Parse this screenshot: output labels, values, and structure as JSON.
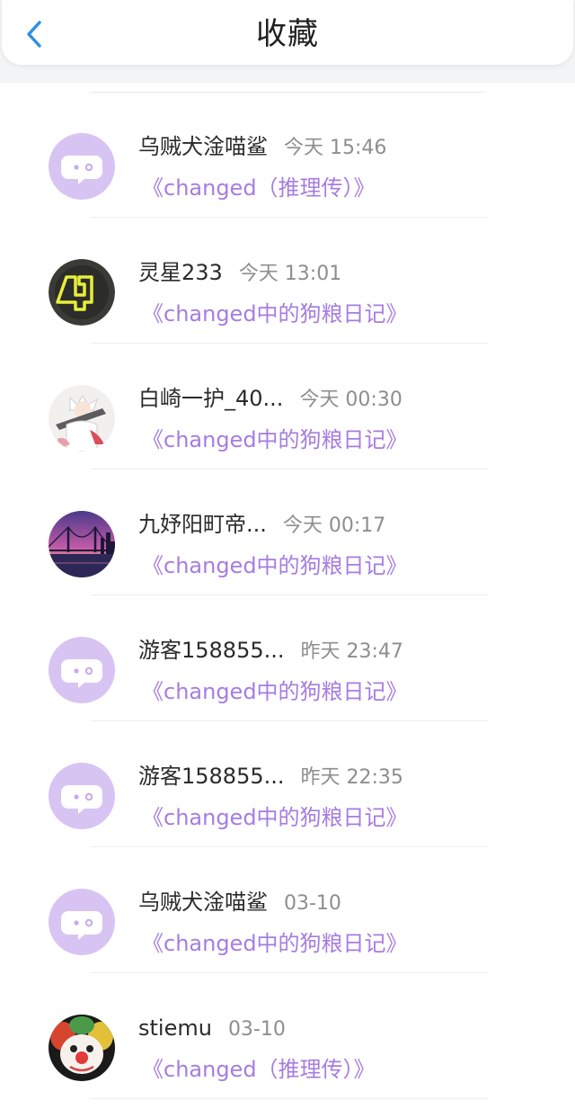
{
  "header": {
    "title": "收藏",
    "back_icon": "chevron-left-icon",
    "accent_color": "#2f8fe6"
  },
  "colors": {
    "book_link": "#a67de0",
    "default_avatar_bg": "#d8c4f3",
    "name_text": "#2b2b2b",
    "time_text": "#8e8e8e"
  },
  "favorites": [
    {
      "name": "乌贼犬淦喵鲨",
      "time": "今天 15:46",
      "book": "《changed（推理传）》",
      "avatar": "default-avatar-icon"
    },
    {
      "name": "灵星233",
      "time": "今天 13:01",
      "book": "《changed中的狗粮日记》",
      "avatar": "yellow-logo-avatar"
    },
    {
      "name": "白崎一护_40...",
      "time": "今天 00:30",
      "book": "《changed中的狗粮日记》",
      "avatar": "anime-character-avatar"
    },
    {
      "name": "九妤阳町帝...",
      "time": "今天 00:17",
      "book": "《changed中的狗粮日记》",
      "avatar": "bridge-sunset-avatar"
    },
    {
      "name": "游客158855...",
      "time": "昨天 23:47",
      "book": "《changed中的狗粮日记》",
      "avatar": "default-avatar-icon"
    },
    {
      "name": "游客158855...",
      "time": "昨天 22:35",
      "book": "《changed中的狗粮日记》",
      "avatar": "default-avatar-icon"
    },
    {
      "name": "乌贼犬淦喵鲨",
      "time": "03-10",
      "book": "《changed中的狗粮日记》",
      "avatar": "default-avatar-icon"
    },
    {
      "name": "stiemu",
      "time": "03-10",
      "book": "《changed（推理传）》",
      "avatar": "clown-avatar"
    }
  ]
}
